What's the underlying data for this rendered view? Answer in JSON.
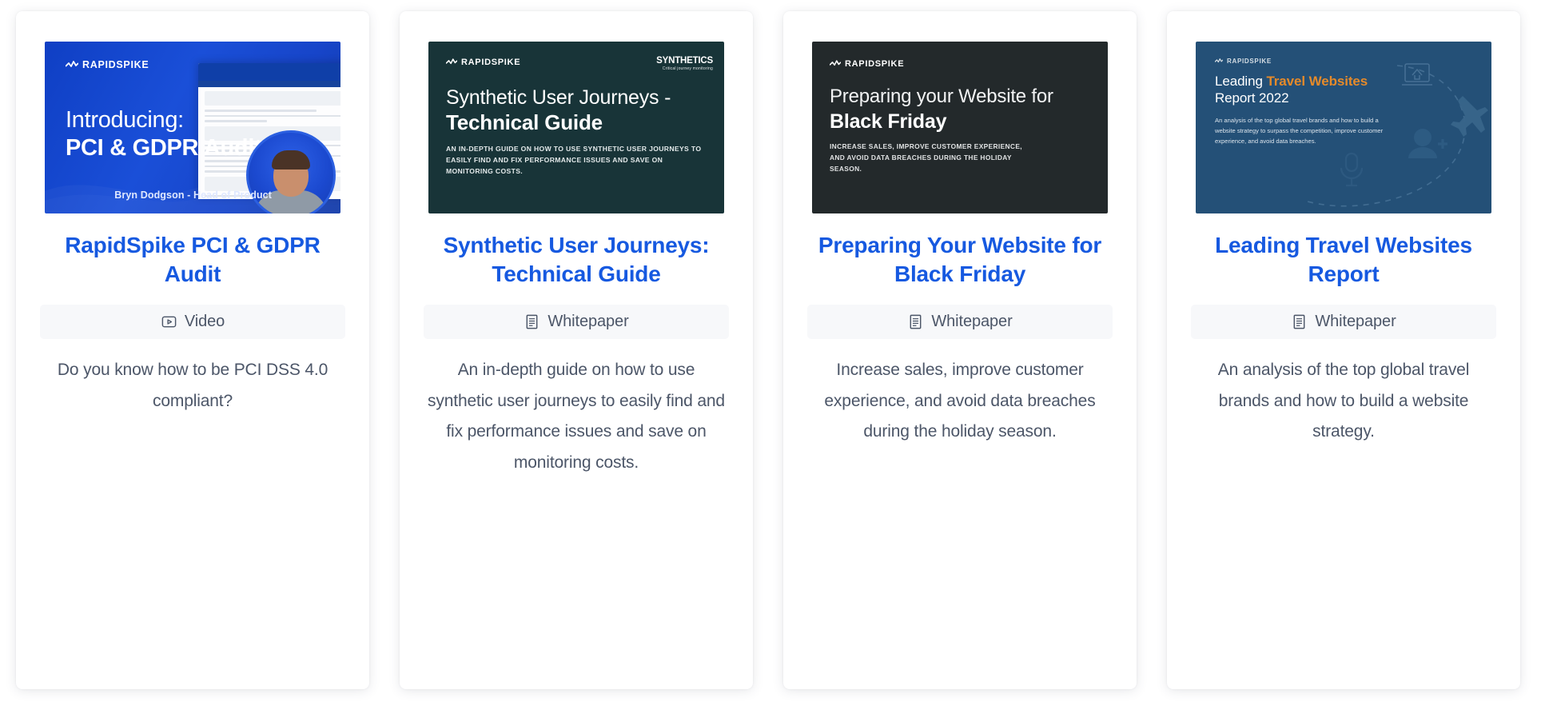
{
  "cards": [
    {
      "thumbnail": {
        "style": "video",
        "brand": "RAPIDSPIKE",
        "heading": "Introducing:",
        "subheading": "PCI & GDPR Audit",
        "credit": "Bryn Dodgson - Head of Product",
        "screen_title": "PCI & GDPR Audit",
        "bg_color": "#1a4fd8"
      },
      "title": "RapidSpike PCI & GDPR Audit",
      "badge": {
        "label": "Video",
        "icon": "video-icon"
      },
      "description": "Do you know how to be PCI DSS 4.0 compliant?"
    },
    {
      "thumbnail": {
        "style": "teal",
        "brand": "RAPIDSPIKE",
        "heading": "Synthetic User Journeys -",
        "subheading": "Technical Guide",
        "body": "AN IN-DEPTH GUIDE ON HOW TO USE SYNTHETIC USER JOURNEYS TO EASILY FIND AND FIX PERFORMANCE ISSUES AND SAVE ON MONITORING COSTS.",
        "corner_logo_name": "SYNTHETICS",
        "corner_logo_tagline": "Critical journey monitoring",
        "bg_color": "#183438"
      },
      "title": "Synthetic User Journeys: Technical Guide",
      "badge": {
        "label": "Whitepaper",
        "icon": "document-icon"
      },
      "description": "An in-depth guide on how to use synthetic user journeys to easily find and fix performance issues and save on monitoring costs."
    },
    {
      "thumbnail": {
        "style": "dark",
        "brand": "RAPIDSPIKE",
        "heading": "Preparing your Website for",
        "subheading": "Black Friday",
        "body": "INCREASE SALES, IMPROVE CUSTOMER EXPERIENCE, AND AVOID DATA BREACHES DURING THE HOLIDAY SEASON.",
        "bg_color": "#23292b"
      },
      "title": "Preparing Your Website for Black Friday",
      "badge": {
        "label": "Whitepaper",
        "icon": "document-icon"
      },
      "description": "Increase sales, improve customer experience, and avoid data breaches during the holiday season."
    },
    {
      "thumbnail": {
        "style": "navy",
        "brand": "RAPIDSPIKE",
        "heading_lead": "Leading ",
        "heading_highlight": "Travel Websites",
        "heading_line2": "Report 2022",
        "body": "An analysis of the top global travel brands and how to build a website strategy to surpass the competition, improve customer experience, and avoid data breaches.",
        "bg_color": "#245077",
        "highlight_color": "#e58a2a"
      },
      "title": "Leading Travel Websites Report",
      "badge": {
        "label": "Whitepaper",
        "icon": "document-icon"
      },
      "description": "An analysis of the top global travel brands and how to build a website strategy."
    }
  ],
  "colors": {
    "title": "#1659e0",
    "body_text": "#4c5668",
    "badge_bg": "#f7f8fa",
    "card_bg": "#ffffff"
  }
}
